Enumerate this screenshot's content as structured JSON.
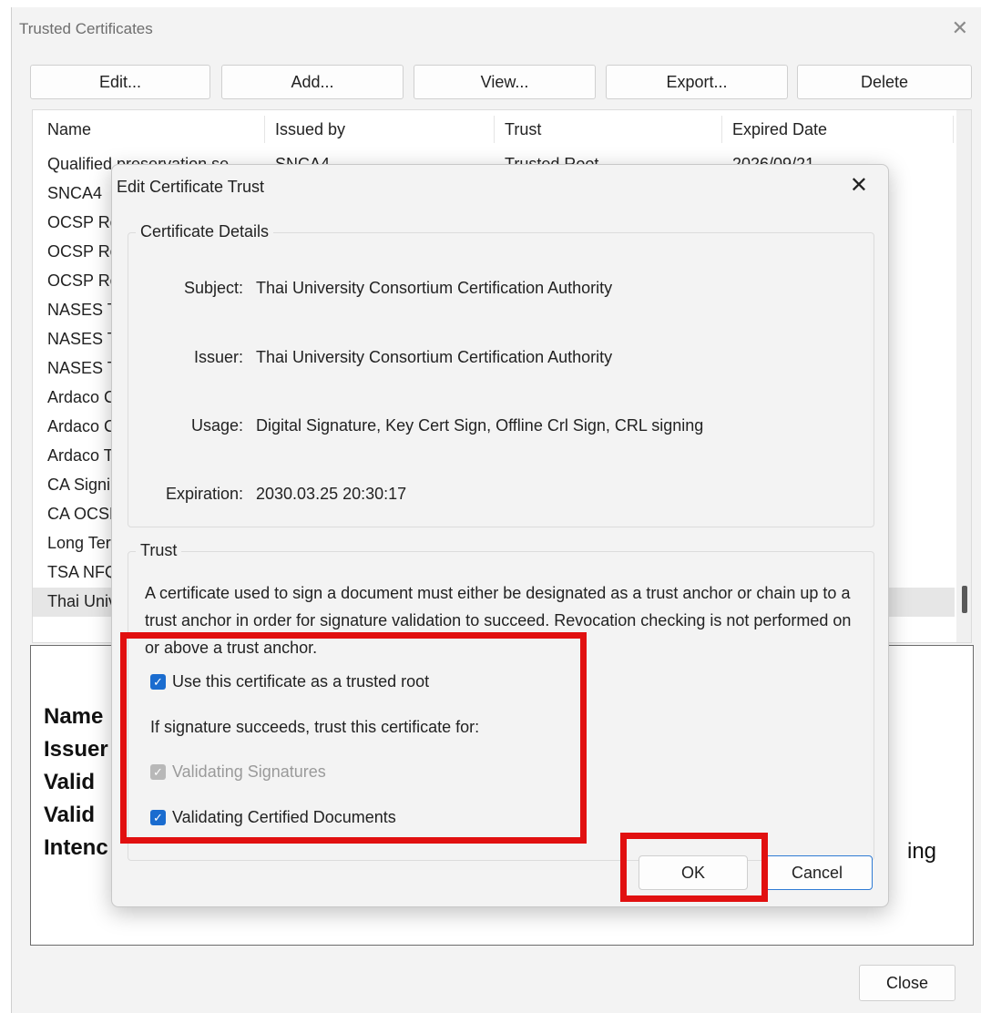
{
  "window": {
    "title": "Trusted Certificates",
    "close_glyph": "✕"
  },
  "toolbar": {
    "edit": "Edit...",
    "add": "Add...",
    "view": "View...",
    "export": "Export...",
    "delete": "Delete"
  },
  "table": {
    "columns": [
      "Name",
      "Issued by",
      "Trust",
      "Expired Date"
    ],
    "rows": [
      {
        "name": "Qualified preservation se...",
        "issued_by": "SNCA4",
        "trust": "Trusted Root",
        "expired": "2026/09/21"
      },
      {
        "name": "SNCA4"
      },
      {
        "name": "OCSP Res"
      },
      {
        "name": "OCSP Res"
      },
      {
        "name": "OCSP Res"
      },
      {
        "name": "NASES Ti"
      },
      {
        "name": "NASES Ti"
      },
      {
        "name": "NASES Ti"
      },
      {
        "name": "Ardaco C"
      },
      {
        "name": "Ardaco C"
      },
      {
        "name": "Ardaco T"
      },
      {
        "name": "CA Signir"
      },
      {
        "name": "CA OCSP"
      },
      {
        "name": "Long Terr"
      },
      {
        "name": "TSA NFQ"
      },
      {
        "name": "Thai Univ"
      }
    ]
  },
  "details": {
    "labels": [
      "Name",
      "Issuer",
      "Valid",
      "Valid",
      "Intenc"
    ],
    "tail": "ing"
  },
  "close_label": "Close",
  "dialog": {
    "title": "Edit Certificate Trust",
    "close_glyph": "✕",
    "details_legend": "Certificate Details",
    "fields": [
      {
        "label": "Subject:",
        "value": "Thai University Consortium Certification Authority"
      },
      {
        "label": "Issuer:",
        "value": "Thai University Consortium Certification Authority"
      },
      {
        "label": "Usage:",
        "value": "Digital Signature, Key Cert Sign, Offline Crl Sign, CRL signing"
      },
      {
        "label": "Expiration:",
        "value": "2030.03.25 20:30:17"
      }
    ],
    "trust_legend": "Trust",
    "trust_description": "A certificate used to sign a document must either be designated as a trust anchor or chain up to a trust anchor in order for signature validation to succeed. Revocation checking is not performed on or above a trust anchor.",
    "trusted_root_label": "Use this certificate as a trusted root",
    "trust_for_label": "If signature succeeds, trust this certificate for:",
    "validating_signatures_label": "Validating Signatures",
    "validating_certified_label": "Validating Certified Documents",
    "ok_label": "OK",
    "cancel_label": "Cancel",
    "check_glyph": "✓"
  },
  "colors": {
    "highlight": "#e11010",
    "checkbox_on": "#1a6ccf",
    "accent_border": "#2f7bd4"
  }
}
